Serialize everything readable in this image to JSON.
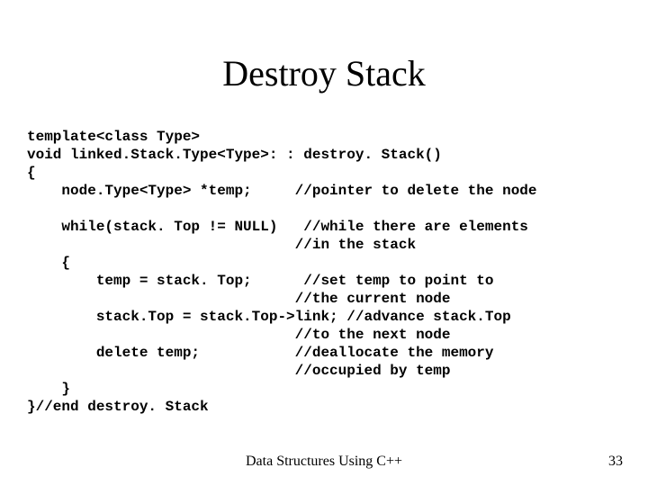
{
  "title": "Destroy Stack",
  "code": "template<class Type>\nvoid linked.Stack.Type<Type>: : destroy. Stack()\n{\n    node.Type<Type> *temp;     //pointer to delete the node\n\n    while(stack. Top != NULL)   //while there are elements\n                               //in the stack\n    {\n        temp = stack. Top;      //set temp to point to\n                               //the current node\n        stack.Top = stack.Top->link; //advance stack.Top\n                               //to the next node\n        delete temp;           //deallocate the memory\n                               //occupied by temp\n    }\n}//end destroy. Stack",
  "footer": "Data Structures Using C++",
  "page_number": "33"
}
